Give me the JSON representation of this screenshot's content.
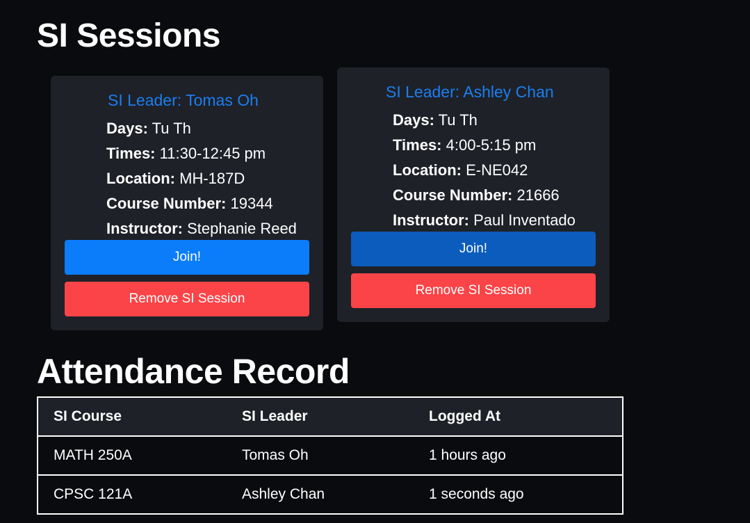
{
  "sessions_heading": "SI Sessions",
  "sessions": [
    {
      "leader_label": "SI Leader: Tomas Oh",
      "days_key": "Days:",
      "days": "Tu Th",
      "times_key": "Times:",
      "times": "11:30-12:45 pm",
      "location_key": "Location:",
      "location": "MH-187D",
      "course_number_key": "Course Number:",
      "course_number": "19344",
      "instructor_key": "Instructor:",
      "instructor": "Stephanie Reed",
      "join_label": "Join!",
      "remove_label": "Remove SI Session"
    },
    {
      "leader_label": "SI Leader: Ashley Chan",
      "days_key": "Days:",
      "days": "Tu Th",
      "times_key": "Times:",
      "times": "4:00-5:15 pm",
      "location_key": "Location:",
      "location": "E-NE042",
      "course_number_key": "Course Number:",
      "course_number": "21666",
      "instructor_key": "Instructor:",
      "instructor": "Paul Inventado",
      "join_label": "Join!",
      "remove_label": "Remove SI Session"
    }
  ],
  "attendance_heading": "Attendance Record",
  "attendance": {
    "headers": [
      "SI Course",
      "SI Leader",
      "Logged At"
    ],
    "rows": [
      [
        "MATH 250A",
        "Tomas Oh",
        "1 hours ago"
      ],
      [
        "CPSC 121A",
        "Ashley Chan",
        "1 seconds ago"
      ]
    ]
  },
  "colors": {
    "background": "#0a0b0e",
    "card": "#1e2128",
    "leader_text": "#1b7ef0",
    "join_button": "#0b7dfb",
    "join_button_hover": "#0c5cbd",
    "remove_button": "#fb4448"
  }
}
